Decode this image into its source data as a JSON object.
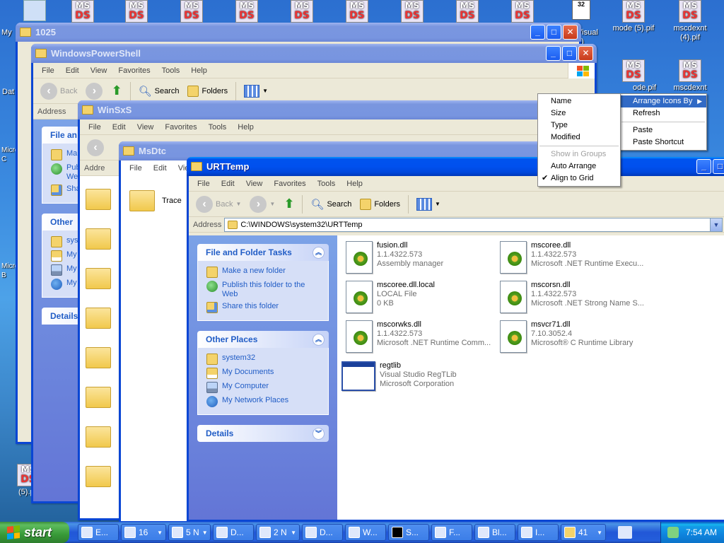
{
  "desktop": {
    "icons": [
      {
        "label": "My",
        "x": 0
      },
      {
        "label": "Visual\n6)",
        "x": 0
      },
      {
        "label": "mode (5).pif",
        "x": 0
      },
      {
        "label": "mscdexnt\n(4).pif",
        "x": 0
      },
      {
        "label": "ode.pif",
        "x": 0
      },
      {
        "label": "mscdexnt",
        "x": 0
      },
      {
        "label": "Dat",
        "x": 0
      },
      {
        "label": "Micro\nC",
        "x": 0
      },
      {
        "label": "Micro\nB",
        "x": 0
      },
      {
        "label": "(5).pif",
        "x": 0
      }
    ]
  },
  "windows": {
    "w1025": {
      "title": "1025"
    },
    "ps": {
      "title": "WindowsPowerShell",
      "menu": [
        "File",
        "Edit",
        "View",
        "Favorites",
        "Tools",
        "Help"
      ],
      "back": "Back",
      "search": "Search",
      "folders": "Folders",
      "address": "Address",
      "tasks_title": "File an",
      "tasks": [
        "Ma",
        "Pub\nWe",
        "Sha"
      ],
      "other_title": "Other",
      "other": [
        "sys",
        "My",
        "My",
        "My"
      ],
      "details": "Details"
    },
    "winsxs": {
      "title": "WinSxS",
      "menu": [
        "File",
        "Edit",
        "View",
        "Favorites",
        "Tools",
        "Help"
      ],
      "address": "Addre"
    },
    "msdtc": {
      "title": "MsDtc",
      "menu": [
        "File",
        "Edit",
        "View"
      ],
      "item": "Trace"
    },
    "urt": {
      "title": "URTTemp",
      "menu": [
        "File",
        "Edit",
        "View",
        "Favorites",
        "Tools",
        "Help"
      ],
      "back": "Back",
      "search": "Search",
      "folders": "Folders",
      "address_label": "Address",
      "address_value": "C:\\WINDOWS\\system32\\URTTemp",
      "tasks_title": "File and Folder Tasks",
      "tasks": [
        "Make a new folder",
        "Publish this folder to the Web",
        "Share this folder"
      ],
      "other_title": "Other Places",
      "other": [
        "system32",
        "My Documents",
        "My Computer",
        "My Network Places"
      ],
      "details_title": "Details",
      "files": [
        {
          "name": "fusion.dll",
          "l1": "1.1.4322.573",
          "l2": "Assembly manager"
        },
        {
          "name": "mscoree.dll",
          "l1": "1.1.4322.573",
          "l2": "Microsoft .NET Runtime Execu..."
        },
        {
          "name": "mscoree.dll.local",
          "l1": "LOCAL File",
          "l2": "0 KB"
        },
        {
          "name": "mscorsn.dll",
          "l1": "1.1.4322.573",
          "l2": "Microsoft .NET Strong Name S..."
        },
        {
          "name": "mscorwks.dll",
          "l1": "1.1.4322.573",
          "l2": "Microsoft .NET Runtime Comm..."
        },
        {
          "name": "msvcr71.dll",
          "l1": "7.10.3052.4",
          "l2": "Microsoft® C Runtime Library"
        },
        {
          "name": "regtlib",
          "l1": "Visual Studio RegTLib",
          "l2": "Microsoft Corporation"
        }
      ]
    }
  },
  "context_menu": {
    "main": [
      "Arrange Icons By",
      "Refresh",
      "Paste",
      "Paste Shortcut"
    ],
    "sub": [
      "Name",
      "Size",
      "Type",
      "Modified",
      "Show in Groups",
      "Auto Arrange",
      "Align to Grid"
    ]
  },
  "taskbar": {
    "start": "start",
    "tasks": [
      "E...",
      "16",
      "5 N",
      "D...",
      "2 N",
      "D...",
      "W...",
      "S...",
      "F...",
      "Bl...",
      "I...",
      "41"
    ],
    "clock": "7:54 AM"
  }
}
